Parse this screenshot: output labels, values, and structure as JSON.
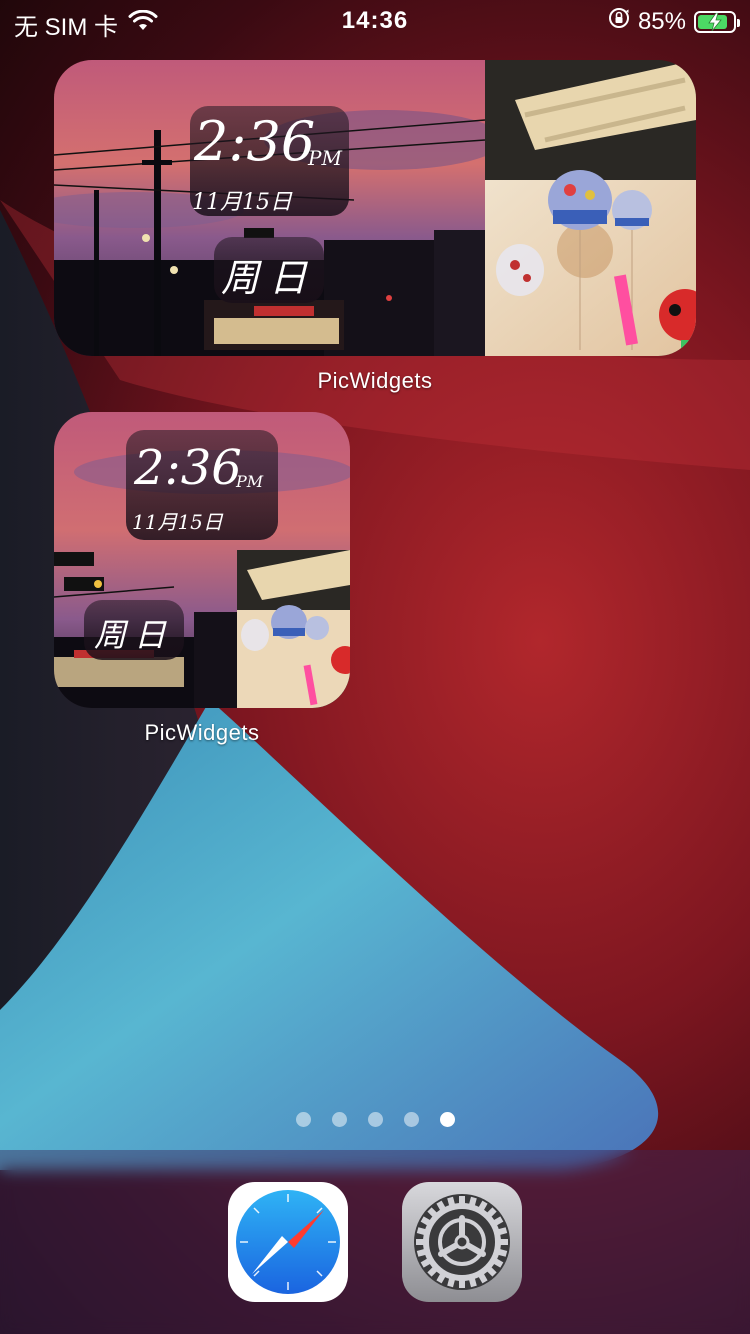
{
  "status_bar": {
    "carrier": "无 SIM 卡",
    "time": "14:36",
    "battery_percent": "85%",
    "battery_level": 0.85
  },
  "widget_large": {
    "time": "2:36",
    "ampm": "PM",
    "date": "11月15日",
    "weekday": "周日",
    "label": "PicWidgets"
  },
  "widget_small": {
    "time": "2:36",
    "ampm": "PM",
    "date": "11月15日",
    "weekday": "周日",
    "label": "PicWidgets"
  },
  "pager": {
    "page_count": 5,
    "current_page": 5
  },
  "dock": {
    "apps": [
      {
        "name": "Safari",
        "icon": "safari-compass-icon"
      },
      {
        "name": "Settings",
        "icon": "settings-gear-icon"
      }
    ]
  },
  "colors": {
    "wallpaper_red": "#b1272c",
    "wallpaper_blue": "#5ab9d3",
    "battery_green": "#4cd964"
  }
}
